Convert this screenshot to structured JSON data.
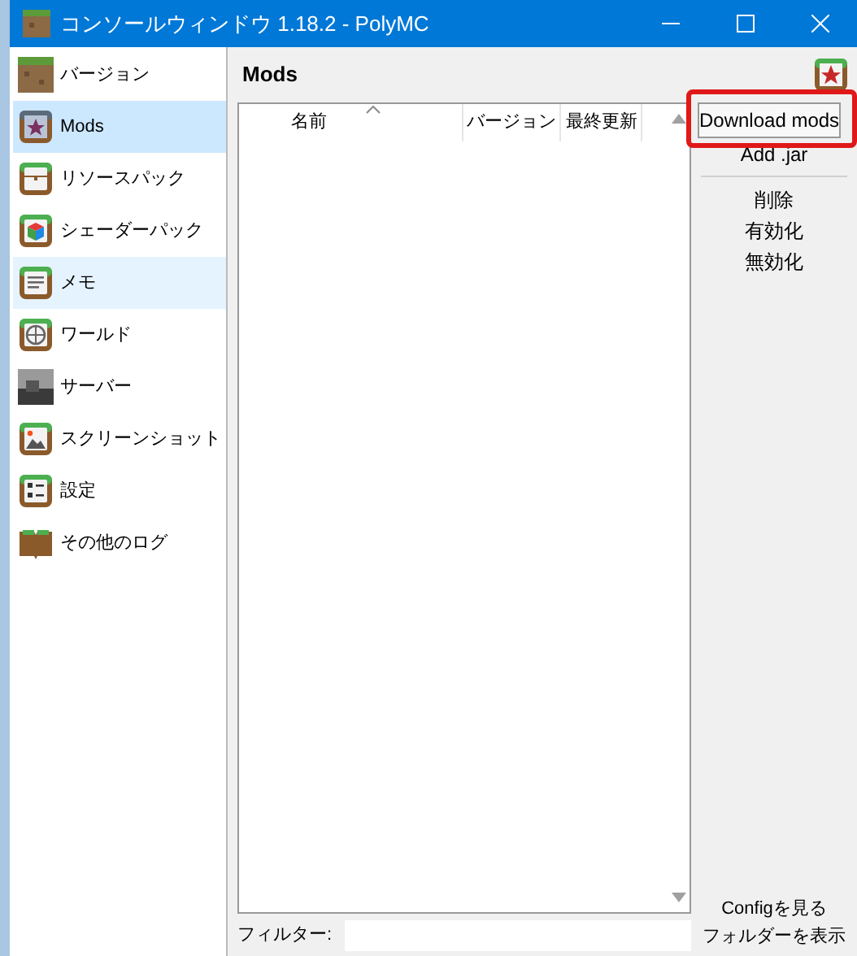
{
  "window": {
    "title": "コンソールウィンドウ 1.18.2 - PolyMC"
  },
  "sidebar": {
    "items": [
      {
        "label": "バージョン",
        "selected": false,
        "hovered": false
      },
      {
        "label": "Mods",
        "selected": true,
        "hovered": false
      },
      {
        "label": "リソースパック",
        "selected": false,
        "hovered": false
      },
      {
        "label": "シェーダーパック",
        "selected": false,
        "hovered": false
      },
      {
        "label": "メモ",
        "selected": false,
        "hovered": true
      },
      {
        "label": "ワールド",
        "selected": false,
        "hovered": false
      },
      {
        "label": "サーバー",
        "selected": false,
        "hovered": false
      },
      {
        "label": "スクリーンショット",
        "selected": false,
        "hovered": false
      },
      {
        "label": "設定",
        "selected": false,
        "hovered": false
      },
      {
        "label": "その他のログ",
        "selected": false,
        "hovered": false
      }
    ]
  },
  "page": {
    "title": "Mods"
  },
  "table": {
    "columns": [
      "名前",
      "バージョン",
      "最終更新"
    ]
  },
  "actions": [
    {
      "label": "Download mods",
      "kind": "default",
      "highlighted": true
    },
    {
      "label": "Add .jar",
      "kind": "button",
      "highlighted": false
    },
    {
      "kind": "separator"
    },
    {
      "label": "削除",
      "kind": "button",
      "highlighted": false
    },
    {
      "label": "有効化",
      "kind": "button",
      "highlighted": false
    },
    {
      "label": "無効化",
      "kind": "button",
      "highlighted": false
    }
  ],
  "bottom_actions": [
    "Configを見る",
    "フォルダーを表示"
  ],
  "filter": {
    "label": "フィルター:"
  }
}
